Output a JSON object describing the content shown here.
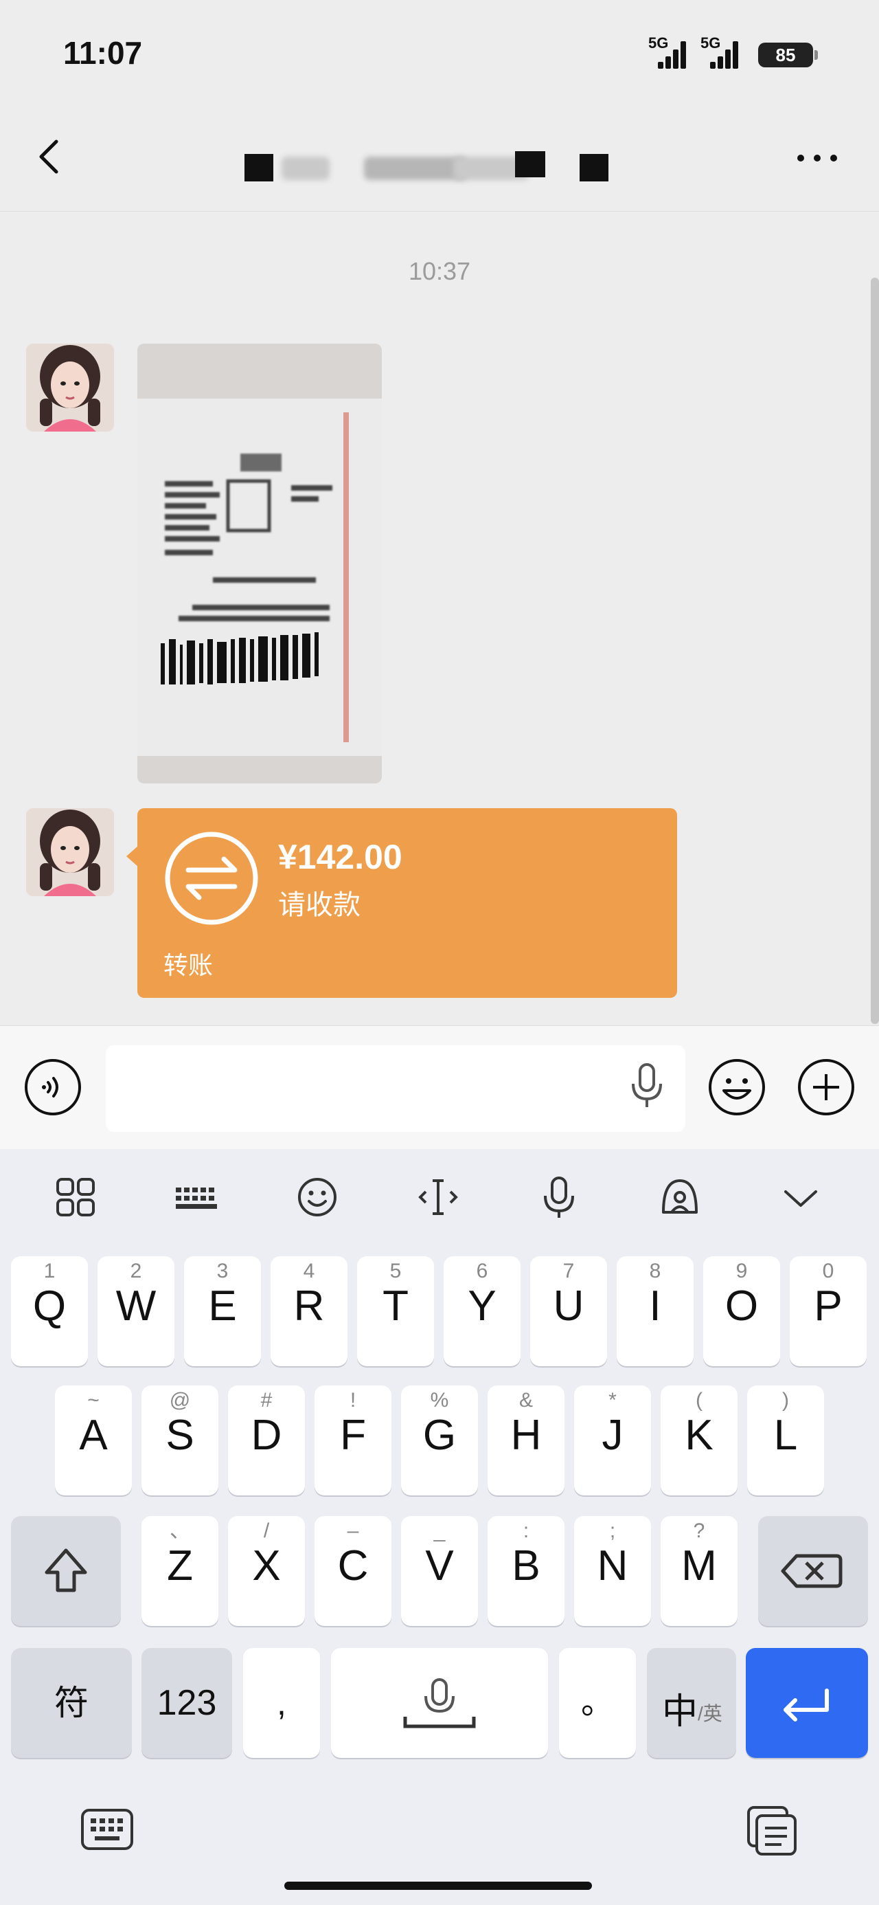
{
  "status_bar": {
    "time": "11:07",
    "network1": "5G",
    "network2": "5G",
    "battery": "85"
  },
  "nav": {
    "back": "back-icon",
    "more": "more-icon"
  },
  "chat": {
    "timestamp": "10:37",
    "messages": [
      {
        "type": "image",
        "sender": "contact"
      },
      {
        "type": "transfer",
        "sender": "contact",
        "amount": "¥142.00",
        "status": "请收款",
        "label": "转账"
      }
    ]
  },
  "input": {
    "value": "",
    "placeholder": ""
  },
  "keyboard": {
    "row1": [
      {
        "k": "Q",
        "s": "1"
      },
      {
        "k": "W",
        "s": "2"
      },
      {
        "k": "E",
        "s": "3"
      },
      {
        "k": "R",
        "s": "4"
      },
      {
        "k": "T",
        "s": "5"
      },
      {
        "k": "Y",
        "s": "6"
      },
      {
        "k": "U",
        "s": "7"
      },
      {
        "k": "I",
        "s": "8"
      },
      {
        "k": "O",
        "s": "9"
      },
      {
        "k": "P",
        "s": "0"
      }
    ],
    "row2": [
      {
        "k": "A",
        "s": "~"
      },
      {
        "k": "S",
        "s": "@"
      },
      {
        "k": "D",
        "s": "#"
      },
      {
        "k": "F",
        "s": "!"
      },
      {
        "k": "G",
        "s": "%"
      },
      {
        "k": "H",
        "s": "&"
      },
      {
        "k": "J",
        "s": "*"
      },
      {
        "k": "K",
        "s": "("
      },
      {
        "k": "L",
        "s": ")"
      }
    ],
    "row3": [
      {
        "k": "Z",
        "s": "、"
      },
      {
        "k": "X",
        "s": "/"
      },
      {
        "k": "C",
        "s": "–"
      },
      {
        "k": "V",
        "s": "_"
      },
      {
        "k": "B",
        "s": ":"
      },
      {
        "k": "N",
        "s": ";"
      },
      {
        "k": "M",
        "s": "?"
      }
    ],
    "symbols_key": "符",
    "numbers_key": "123",
    "comma_key": ",",
    "period_key": "。",
    "lang_key_main": "中",
    "lang_key_sub": "/英"
  },
  "colors": {
    "transfer": "#ef9f4b",
    "enter": "#2f6bf2",
    "background": "#ededed"
  }
}
